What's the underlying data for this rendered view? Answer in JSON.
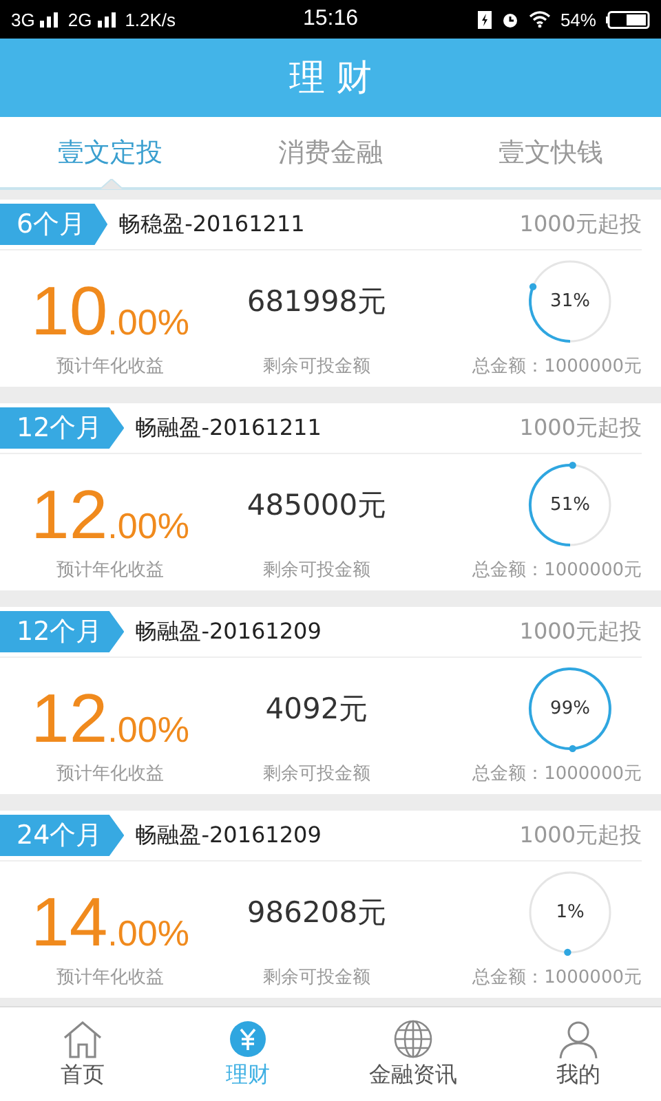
{
  "status_bar": {
    "left": "3G",
    "left2": "2G",
    "speed": "1.2K/s",
    "time": "15:16",
    "battery": "54%"
  },
  "header": {
    "title": "理 财"
  },
  "tabs": [
    {
      "label": "壹文定投",
      "selected": true
    },
    {
      "label": "消费金融",
      "selected": false
    },
    {
      "label": "壹文快钱",
      "selected": false
    }
  ],
  "products": [
    {
      "term": "6个月",
      "name": "畅稳盈-20161211",
      "minimum": "1000元起投",
      "rate": "10",
      "rate_decimal": ".00%",
      "rate_label": "预计年化收益",
      "remaining": "681998元",
      "remaining_label": "剩余可投金额",
      "progress": "31%",
      "total": "总金额：1000000元"
    },
    {
      "term": "12个月",
      "name": "畅融盈-20161211",
      "minimum": "1000元起投",
      "rate": "12",
      "rate_decimal": ".00%",
      "rate_label": "预计年化收益",
      "remaining": "485000元",
      "remaining_label": "剩余可投金额",
      "progress": "51%",
      "total": "总金额：1000000元"
    },
    {
      "term": "12个月",
      "name": "畅融盈-20161209",
      "minimum": "1000元起投",
      "rate": "12",
      "rate_decimal": ".00%",
      "rate_label": "预计年化收益",
      "remaining": "4092元",
      "remaining_label": "剩余可投金额",
      "progress": "99%",
      "total": "总金额：1000000元"
    },
    {
      "term": "24个月",
      "name": "畅融盈-20161209",
      "minimum": "1000元起投",
      "rate": "14",
      "rate_decimal": ".00%",
      "rate_label": "预计年化收益",
      "remaining": "986208元",
      "remaining_label": "剩余可投金额",
      "progress": "1%",
      "total": "总金额：1000000元"
    }
  ],
  "bottom_nav": [
    {
      "label": "首页",
      "kind": "home",
      "selected": false
    },
    {
      "label": "理财",
      "kind": "finance",
      "selected": true
    },
    {
      "label": "金融资讯",
      "kind": "news",
      "selected": false
    },
    {
      "label": "我的",
      "kind": "profile",
      "selected": false
    }
  ]
}
